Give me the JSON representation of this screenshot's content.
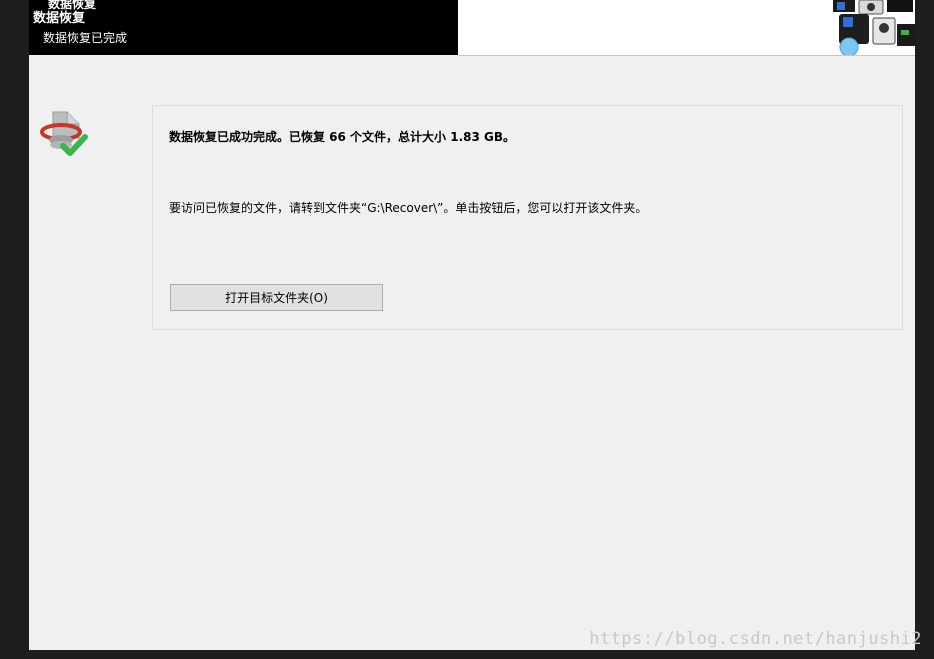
{
  "header": {
    "ghost_title": "数据恢复",
    "title": "数据恢复",
    "subtitle": "数据恢复已完成"
  },
  "icons": {
    "status": "disk-check-icon",
    "banner": "devices-banner-icon"
  },
  "panel": {
    "summary": "数据恢复已成功完成。已恢复 66 个文件，总计大小 1.83 GB。",
    "instruction": "要访问已恢复的文件，请转到文件夹“G:\\Recover\\”。单击按钮后，您可以打开该文件夹。",
    "open_button_label": "打开目标文件夹(O)"
  },
  "watermark": "https://blog.csdn.net/hanjushi2",
  "colors": {
    "window_bg": "#f0f0f0",
    "header_bg": "#000000",
    "check_green": "#3cb44b",
    "ring_red": "#c0392b"
  }
}
